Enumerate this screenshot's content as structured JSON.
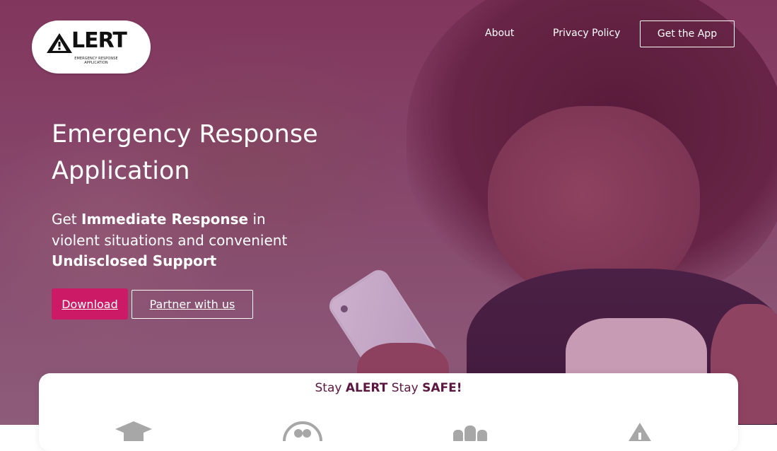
{
  "logo": {
    "wordmark": "LERT",
    "tagline": "EMERGENCY RESPONSE APPLICATION"
  },
  "nav": {
    "about": "About",
    "privacy_policy": "Privacy Policy",
    "get_app": "Get the App"
  },
  "hero": {
    "title": "Emergency Response Application",
    "subtitle_prefix": "Get ",
    "subtitle_bold1": "Immediate Response",
    "subtitle_middle": " in violent situations and convenient ",
    "subtitle_bold2": "Undisclosed Support",
    "download_label": "Download",
    "partner_label": "Partner with us"
  },
  "card": {
    "title_prefix": "Stay ",
    "title_bold1": "ALERT",
    "title_middle": " Stay ",
    "title_bold2": "SAFE!"
  },
  "features": [
    {
      "icon": "graduation-cap-icon"
    },
    {
      "icon": "community-icon"
    },
    {
      "icon": "people-group-icon"
    },
    {
      "icon": "warning-icon"
    }
  ],
  "colors": {
    "accent": "#cc1a66",
    "hero_tint": "#7d3c5e",
    "card_title": "#5b1740",
    "icon_gray": "#a7a7a7"
  }
}
